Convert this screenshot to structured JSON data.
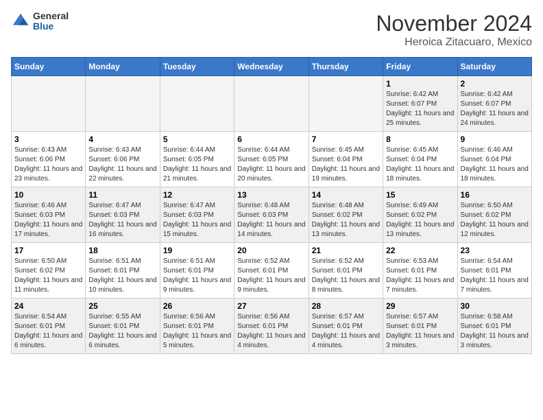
{
  "header": {
    "logo": {
      "general": "General",
      "blue": "Blue"
    },
    "title": "November 2024",
    "location": "Heroica Zitacuaro, Mexico"
  },
  "days_of_week": [
    "Sunday",
    "Monday",
    "Tuesday",
    "Wednesday",
    "Thursday",
    "Friday",
    "Saturday"
  ],
  "weeks": [
    [
      {
        "day": "",
        "empty": true
      },
      {
        "day": "",
        "empty": true
      },
      {
        "day": "",
        "empty": true
      },
      {
        "day": "",
        "empty": true
      },
      {
        "day": "",
        "empty": true
      },
      {
        "day": "1",
        "sunrise": "6:42 AM",
        "sunset": "6:07 PM",
        "daylight": "11 hours and 25 minutes."
      },
      {
        "day": "2",
        "sunrise": "6:42 AM",
        "sunset": "6:07 PM",
        "daylight": "11 hours and 24 minutes."
      }
    ],
    [
      {
        "day": "3",
        "sunrise": "6:43 AM",
        "sunset": "6:06 PM",
        "daylight": "11 hours and 23 minutes."
      },
      {
        "day": "4",
        "sunrise": "6:43 AM",
        "sunset": "6:06 PM",
        "daylight": "11 hours and 22 minutes."
      },
      {
        "day": "5",
        "sunrise": "6:44 AM",
        "sunset": "6:05 PM",
        "daylight": "11 hours and 21 minutes."
      },
      {
        "day": "6",
        "sunrise": "6:44 AM",
        "sunset": "6:05 PM",
        "daylight": "11 hours and 20 minutes."
      },
      {
        "day": "7",
        "sunrise": "6:45 AM",
        "sunset": "6:04 PM",
        "daylight": "11 hours and 19 minutes."
      },
      {
        "day": "8",
        "sunrise": "6:45 AM",
        "sunset": "6:04 PM",
        "daylight": "11 hours and 18 minutes."
      },
      {
        "day": "9",
        "sunrise": "6:46 AM",
        "sunset": "6:04 PM",
        "daylight": "11 hours and 18 minutes."
      }
    ],
    [
      {
        "day": "10",
        "sunrise": "6:46 AM",
        "sunset": "6:03 PM",
        "daylight": "11 hours and 17 minutes."
      },
      {
        "day": "11",
        "sunrise": "6:47 AM",
        "sunset": "6:03 PM",
        "daylight": "11 hours and 16 minutes."
      },
      {
        "day": "12",
        "sunrise": "6:47 AM",
        "sunset": "6:03 PM",
        "daylight": "11 hours and 15 minutes."
      },
      {
        "day": "13",
        "sunrise": "6:48 AM",
        "sunset": "6:03 PM",
        "daylight": "11 hours and 14 minutes."
      },
      {
        "day": "14",
        "sunrise": "6:48 AM",
        "sunset": "6:02 PM",
        "daylight": "11 hours and 13 minutes."
      },
      {
        "day": "15",
        "sunrise": "6:49 AM",
        "sunset": "6:02 PM",
        "daylight": "11 hours and 13 minutes."
      },
      {
        "day": "16",
        "sunrise": "6:50 AM",
        "sunset": "6:02 PM",
        "daylight": "11 hours and 12 minutes."
      }
    ],
    [
      {
        "day": "17",
        "sunrise": "6:50 AM",
        "sunset": "6:02 PM",
        "daylight": "11 hours and 11 minutes."
      },
      {
        "day": "18",
        "sunrise": "6:51 AM",
        "sunset": "6:01 PM",
        "daylight": "11 hours and 10 minutes."
      },
      {
        "day": "19",
        "sunrise": "6:51 AM",
        "sunset": "6:01 PM",
        "daylight": "11 hours and 9 minutes."
      },
      {
        "day": "20",
        "sunrise": "6:52 AM",
        "sunset": "6:01 PM",
        "daylight": "11 hours and 9 minutes."
      },
      {
        "day": "21",
        "sunrise": "6:52 AM",
        "sunset": "6:01 PM",
        "daylight": "11 hours and 8 minutes."
      },
      {
        "day": "22",
        "sunrise": "6:53 AM",
        "sunset": "6:01 PM",
        "daylight": "11 hours and 7 minutes."
      },
      {
        "day": "23",
        "sunrise": "6:54 AM",
        "sunset": "6:01 PM",
        "daylight": "11 hours and 7 minutes."
      }
    ],
    [
      {
        "day": "24",
        "sunrise": "6:54 AM",
        "sunset": "6:01 PM",
        "daylight": "11 hours and 6 minutes."
      },
      {
        "day": "25",
        "sunrise": "6:55 AM",
        "sunset": "6:01 PM",
        "daylight": "11 hours and 6 minutes."
      },
      {
        "day": "26",
        "sunrise": "6:56 AM",
        "sunset": "6:01 PM",
        "daylight": "11 hours and 5 minutes."
      },
      {
        "day": "27",
        "sunrise": "6:56 AM",
        "sunset": "6:01 PM",
        "daylight": "11 hours and 4 minutes."
      },
      {
        "day": "28",
        "sunrise": "6:57 AM",
        "sunset": "6:01 PM",
        "daylight": "11 hours and 4 minutes."
      },
      {
        "day": "29",
        "sunrise": "6:57 AM",
        "sunset": "6:01 PM",
        "daylight": "11 hours and 3 minutes."
      },
      {
        "day": "30",
        "sunrise": "6:58 AM",
        "sunset": "6:01 PM",
        "daylight": "11 hours and 3 minutes."
      }
    ]
  ]
}
